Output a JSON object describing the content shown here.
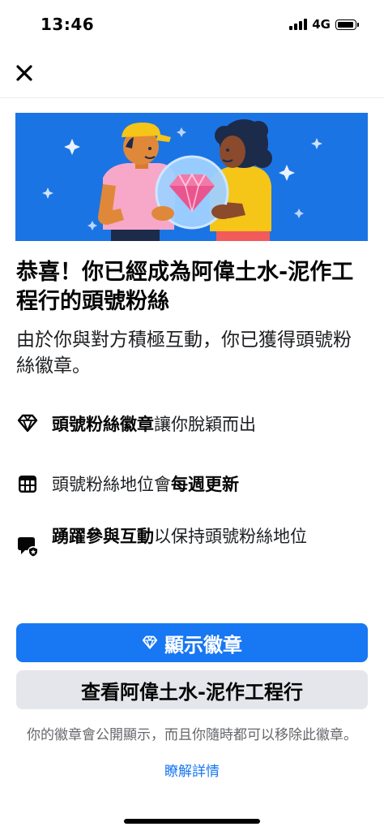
{
  "status_bar": {
    "time": "13:46",
    "network": "4G"
  },
  "header": {
    "close_icon": "close-icon"
  },
  "hero": {
    "icon": "diamond-illustration",
    "background": "#1b74e4"
  },
  "content": {
    "title": "恭喜！你已經成為阿偉土水-泥作工程行的頭號粉絲",
    "subtitle": "由於你與對方積極互動，你已獲得頭號粉絲徽章。"
  },
  "features": [
    {
      "icon": "diamond-icon",
      "bold": "頭號粉絲徽章",
      "text": "讓你脫穎而出"
    },
    {
      "icon": "calendar-icon",
      "text": "頭號粉絲地位會",
      "bold": "每週更新"
    },
    {
      "icon": "comment-badge-icon",
      "bold": "踴躍參與互動",
      "text": "以保持頭號粉絲地位"
    }
  ],
  "actions": {
    "primary_label": "顯示徽章",
    "secondary_label": "查看阿偉土水-泥作工程行"
  },
  "footer": {
    "note": "你的徽章會公開顯示，而且你隨時都可以移除此徽章。",
    "learn_more": "瞭解詳情"
  },
  "colors": {
    "accent": "#1877f2",
    "secondary_button": "#e4e6eb",
    "muted_text": "#65676b"
  }
}
